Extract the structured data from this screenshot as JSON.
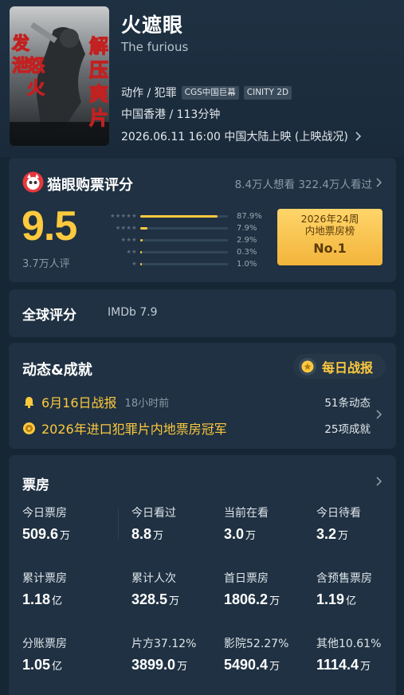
{
  "movie": {
    "title": "火遮眼",
    "english_title": "The furious",
    "genre": "动作 / 犯罪",
    "format_tags": [
      "CGS中国巨幕",
      "CINITY 2D"
    ],
    "region_duration": "中国香港 / 113分钟",
    "release": "2026.06.11 16:00 中国大陆上映 (上映战况)",
    "poster_text": {
      "left": "发泄怒火",
      "right": "解压爽片"
    }
  },
  "rating": {
    "title": "猫眼购票评分",
    "want_watched": "8.4万人想看 322.4万人看过",
    "score": "9.5",
    "count": "3.7万人评",
    "distribution": [
      {
        "stars": "★★★★★",
        "pct_label": "87.9%",
        "pct": 87.9
      },
      {
        "stars": "★★★★",
        "pct_label": "7.9%",
        "pct": 7.9
      },
      {
        "stars": "★★★",
        "pct_label": "2.9%",
        "pct": 2.9
      },
      {
        "stars": "★★",
        "pct_label": "0.3%",
        "pct": 0.3
      },
      {
        "stars": "★",
        "pct_label": "1.0%",
        "pct": 1.0
      }
    ],
    "rank": {
      "line1": "2026年24周",
      "line2": "内地票房榜",
      "no": "No.1"
    }
  },
  "global": {
    "label": "全球评分",
    "imdb": "IMDb 7.9"
  },
  "dynamics": {
    "title": "动态&成就",
    "daily_button": "每日战报",
    "items": [
      {
        "text": "6月16日战报",
        "sub": "18小时前",
        "right": "51条动态"
      },
      {
        "text": "2026年进口犯罪片内地票房冠军",
        "sub": "",
        "right": "25项成就"
      }
    ]
  },
  "box_office": {
    "title": "票房",
    "rows": [
      [
        {
          "label": "今日票房",
          "value": "509.6",
          "unit": "万"
        },
        {
          "label": "今日看过",
          "value": "8.8",
          "unit": "万"
        },
        {
          "label": "当前在看",
          "value": "3.0",
          "unit": "万"
        },
        {
          "label": "今日待看",
          "value": "3.2",
          "unit": "万"
        }
      ],
      [
        {
          "label": "累计票房",
          "value": "1.18",
          "unit": "亿"
        },
        {
          "label": "累计人次",
          "value": "328.5",
          "unit": "万"
        },
        {
          "label": "首日票房",
          "value": "1806.2",
          "unit": "万"
        },
        {
          "label": "含预售票房",
          "value": "1.19",
          "unit": "亿"
        }
      ],
      [
        {
          "label": "分账票房",
          "value": "1.05",
          "unit": "亿"
        },
        {
          "label": "片方37.12%",
          "value": "3899.0",
          "unit": "万"
        },
        {
          "label": "影院52.27%",
          "value": "5490.4",
          "unit": "万"
        },
        {
          "label": "其他10.61%",
          "value": "1114.4",
          "unit": "万"
        }
      ]
    ]
  },
  "colors": {
    "accent": "#fec93e",
    "background": "#172634",
    "card": "#1f3142"
  }
}
